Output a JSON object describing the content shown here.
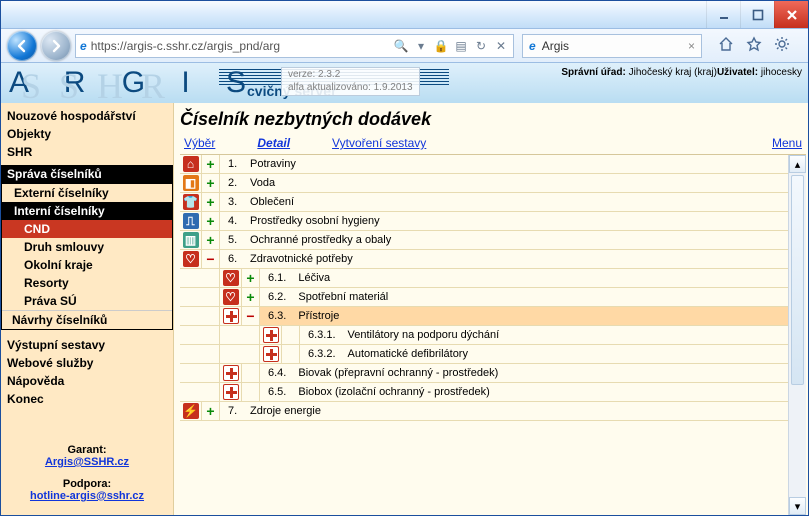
{
  "browser": {
    "url_display": "https://argis-c.sshr.cz/argis_pnd/arg",
    "tab_title": "Argis",
    "search_glyph": "🔍"
  },
  "banner": {
    "app_name": "A R G I S",
    "watermark": "SSHR",
    "server_label": "cvičný server",
    "version_label": "verze: 2.3.2",
    "updated_label": "alfa aktualizováno: 1.9.2013",
    "admin_label": "Správní úřad:",
    "admin_value": "Jihočeský kraj (kraj)",
    "user_label": "Uživatel:",
    "user_value": "jihocesky"
  },
  "left": {
    "items_top": [
      "Nouzové hospodářství",
      "Objekty",
      "SHR"
    ],
    "group_header": "Správa číselníků",
    "group_items": {
      "ext": "Externí číselníky",
      "int": "Interní číselníky",
      "cnd": "CND",
      "druh": "Druh smlouvy",
      "kraje": "Okolní kraje",
      "resorty": "Resorty",
      "prava": "Práva SÚ",
      "navrhy": "Návrhy číselníků"
    },
    "items_bottom": [
      "Výstupní sestavy",
      "Webové služby",
      "Nápověda",
      "Konec"
    ],
    "garant_label": "Garant:",
    "garant_email": "Argis@SSHR.cz",
    "support_label": "Podpora:",
    "support_email": "hotline-argis@sshr.cz"
  },
  "main": {
    "title": "Číselník nezbytných dodávek",
    "tabs": {
      "vyber": "Výběr",
      "detail": "Detail",
      "sestavy": "Vytvoření sestavy",
      "menu": "Menu"
    },
    "rows": {
      "r1_num": "1.",
      "r1_txt": "Potraviny",
      "r2_num": "2.",
      "r2_txt": "Voda",
      "r3_num": "3.",
      "r3_txt": "Oblečení",
      "r4_num": "4.",
      "r4_txt": "Prostředky osobní hygieny",
      "r5_num": "5.",
      "r5_txt": "Ochranné prostředky a obaly",
      "r6_num": "6.",
      "r6_txt": "Zdravotnické potřeby",
      "r61_num": "6.1.",
      "r61_txt": "Léčiva",
      "r62_num": "6.2.",
      "r62_txt": "Spotřební materiál",
      "r63_num": "6.3.",
      "r63_txt": "Přístroje",
      "r631_num": "6.3.1.",
      "r631_txt": "Ventilátory na podporu dýchání",
      "r632_num": "6.3.2.",
      "r632_txt": "Automatické defibrilátory",
      "r64_num": "6.4.",
      "r64_txt": "Biovak (přepravní ochranný - prostředek)",
      "r65_num": "6.5.",
      "r65_txt": "Biobox (izolační ochranný - prostředek)",
      "r7_num": "7.",
      "r7_txt": "Zdroje energie"
    }
  }
}
